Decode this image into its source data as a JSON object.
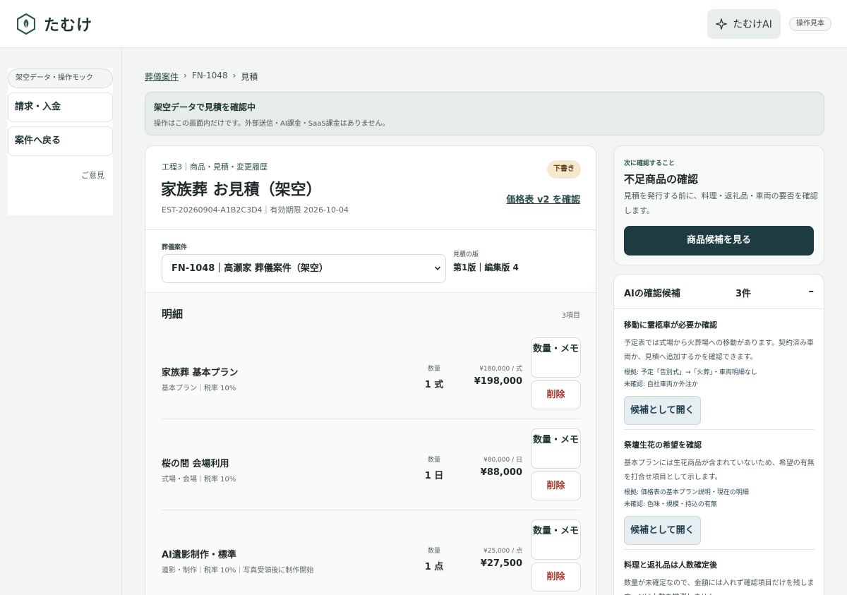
{
  "app": {
    "brand": "たむけ",
    "ai_button_label": "たむけAI",
    "sample_badge": "操作見本",
    "colors": {
      "accent": "#1d3b40",
      "danger": "#a6362b",
      "draft_badge_bg": "#f6e8cf"
    }
  },
  "sidebar": {
    "chip": "架空データ・操作モック",
    "items": [
      {
        "label": "請求・入金"
      },
      {
        "label": "案件へ戻る"
      }
    ],
    "feedback": "ご意見"
  },
  "breadcrumb": {
    "items": [
      "葬儀案件",
      "FN-1048",
      "見積"
    ],
    "separator": "›"
  },
  "notice": {
    "title": "架空データで見積を確認中",
    "subtitle": "操作はこの画面内だけです。外部送信・AI課金・SaaS課金はありません。"
  },
  "estimate": {
    "eyebrow": "工程3｜商品・見積・変更履歴",
    "status": "下書き",
    "title": "家族葬 お見積（架空）",
    "price_link": "価格表 v2 を確認",
    "meta": "EST-20260904-A1B2C3D4｜有効期限 2026-10-04",
    "case_label": "葬儀案件",
    "case_selected": "FN-1048｜高瀬家 葬儀案件（架空）",
    "version_label": "見積の版",
    "version_value": "第1版｜編集版 4",
    "details_title": "明細",
    "details_count": "3項目",
    "qty_label": "数量",
    "memo_button": "数量・メモ",
    "delete_button": "削除",
    "items": [
      {
        "name": "家族葬 基本プラン",
        "sub": "基本プラン｜税率 10%",
        "qty": "1 式",
        "unit_price": "¥180,000 / 式",
        "total": "¥198,000"
      },
      {
        "name": "桜の間 会場利用",
        "sub": "式場・会場｜税率 10%",
        "qty": "1 日",
        "unit_price": "¥80,000 / 日",
        "total": "¥88,000"
      },
      {
        "name": "AI遺影制作・標準",
        "sub": "遺影・制作｜税率 10%｜写真受領後に制作開始",
        "qty": "1 点",
        "unit_price": "¥25,000 / 点",
        "total": "¥27,500"
      }
    ]
  },
  "next_step": {
    "eyebrow": "次に確認すること",
    "title": "不足商品の確認",
    "description": "見積を発行する前に、料理・返礼品・車両の要否を確認します。",
    "button": "商品候補を見る"
  },
  "ai_suggestions": {
    "title": "AIの確認候補",
    "count": "3件",
    "toggle": "–",
    "open_button": "候補として開く",
    "items": [
      {
        "title": "移動に霊柩車が必要か確認",
        "description": "予定表では式場から火葬場への移動があります。契約済み車両か、見積へ追加するかを確認できます。",
        "basis": "根拠: 予定「告別式」→「火葬」・車両明細なし",
        "unconfirmed": "未確認: 自社車両か外注か"
      },
      {
        "title": "祭壇生花の希望を確認",
        "description": "基本プランには生花商品が含まれていないため、希望の有無を打合せ項目として示します。",
        "basis": "根拠: 価格表の基本プラン説明・現在の明細",
        "unconfirmed": "未確認: 色味・規模・持込の有無"
      },
      {
        "title": "料理と返礼品は人数確定後",
        "description": "数量が未確定なので、金額には入れず確認項目だけを残します。AIは人数を推測しません。"
      }
    ]
  }
}
